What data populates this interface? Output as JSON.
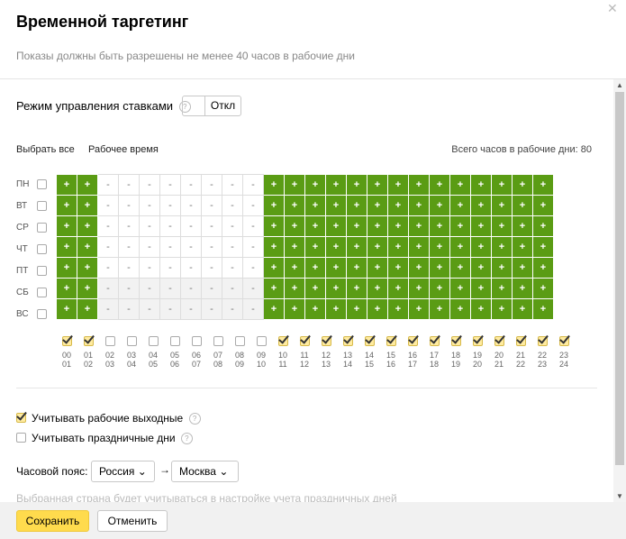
{
  "dialog": {
    "title": "Временной таргетинг",
    "subtitle": "Показы должны быть разрешены не менее 40 часов в рабочие дни",
    "close_icon": "close-icon"
  },
  "bid_mode": {
    "label": "Режим управления ставками",
    "help_glyph": "?",
    "toggle_state": "Откл"
  },
  "toolbar": {
    "select_all": "Выбрать все",
    "work_time": "Рабочее время",
    "total_hours": "Всего часов в рабочие дни: 80"
  },
  "days": [
    "ПН",
    "ВТ",
    "СР",
    "ЧТ",
    "ПТ",
    "СБ",
    "ВС"
  ],
  "active_hours": [
    0,
    1,
    10,
    11,
    12,
    13,
    14,
    15,
    16,
    17,
    18,
    19,
    20,
    21,
    22,
    23
  ],
  "cell_on": "+",
  "cell_off": "-",
  "hour_ranges": [
    {
      "from": "00",
      "to": "01"
    },
    {
      "from": "01",
      "to": "02"
    },
    {
      "from": "02",
      "to": "03"
    },
    {
      "from": "03",
      "to": "04"
    },
    {
      "from": "04",
      "to": "05"
    },
    {
      "from": "05",
      "to": "06"
    },
    {
      "from": "06",
      "to": "07"
    },
    {
      "from": "07",
      "to": "08"
    },
    {
      "from": "08",
      "to": "09"
    },
    {
      "from": "09",
      "to": "10"
    },
    {
      "from": "10",
      "to": "11"
    },
    {
      "from": "11",
      "to": "12"
    },
    {
      "from": "12",
      "to": "13"
    },
    {
      "from": "13",
      "to": "14"
    },
    {
      "from": "14",
      "to": "15"
    },
    {
      "from": "15",
      "to": "16"
    },
    {
      "from": "16",
      "to": "17"
    },
    {
      "from": "17",
      "to": "18"
    },
    {
      "from": "18",
      "to": "19"
    },
    {
      "from": "19",
      "to": "20"
    },
    {
      "from": "20",
      "to": "21"
    },
    {
      "from": "21",
      "to": "22"
    },
    {
      "from": "22",
      "to": "23"
    },
    {
      "from": "23",
      "to": "24"
    }
  ],
  "options": {
    "working_weekends": {
      "label": "Учитывать рабочие выходные",
      "checked": true
    },
    "holidays": {
      "label": "Учитывать праздничные дни",
      "checked": false
    }
  },
  "timezone": {
    "label": "Часовой пояс:",
    "country": "Россия",
    "city": "Москва",
    "arrow": "→",
    "hint": "Выбранная страна будет учитываться в настройке учета праздничных дней"
  },
  "footer": {
    "save_label": "Сохранить",
    "cancel_label": "Отменить"
  },
  "colors": {
    "active_cell": "#5a9c14",
    "save_button": "#ffdb4d"
  }
}
